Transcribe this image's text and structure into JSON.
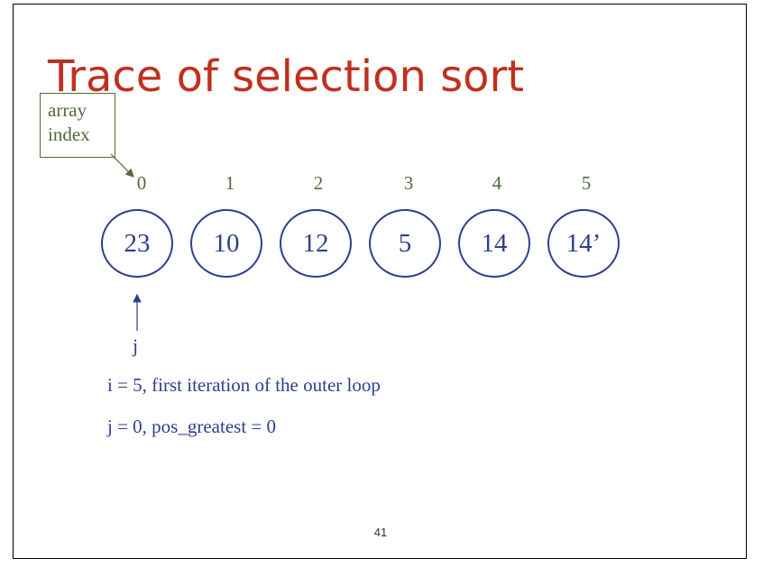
{
  "slide": {
    "title": "Trace of selection sort",
    "callout": {
      "line1": "array",
      "line2": "index"
    },
    "indices": [
      "0",
      "1",
      "2",
      "3",
      "4",
      "5"
    ],
    "values": [
      "23",
      "10",
      "12",
      "5",
      "14",
      "14’"
    ],
    "pointer_label": "j",
    "notes": [
      "i = 5, first iteration of the outer loop",
      "j = 0, pos_greatest = 0"
    ],
    "page_number": "41",
    "colors": {
      "title": "#c0301f",
      "array": "#2e3f8f",
      "index": "#4f6b3a"
    }
  }
}
